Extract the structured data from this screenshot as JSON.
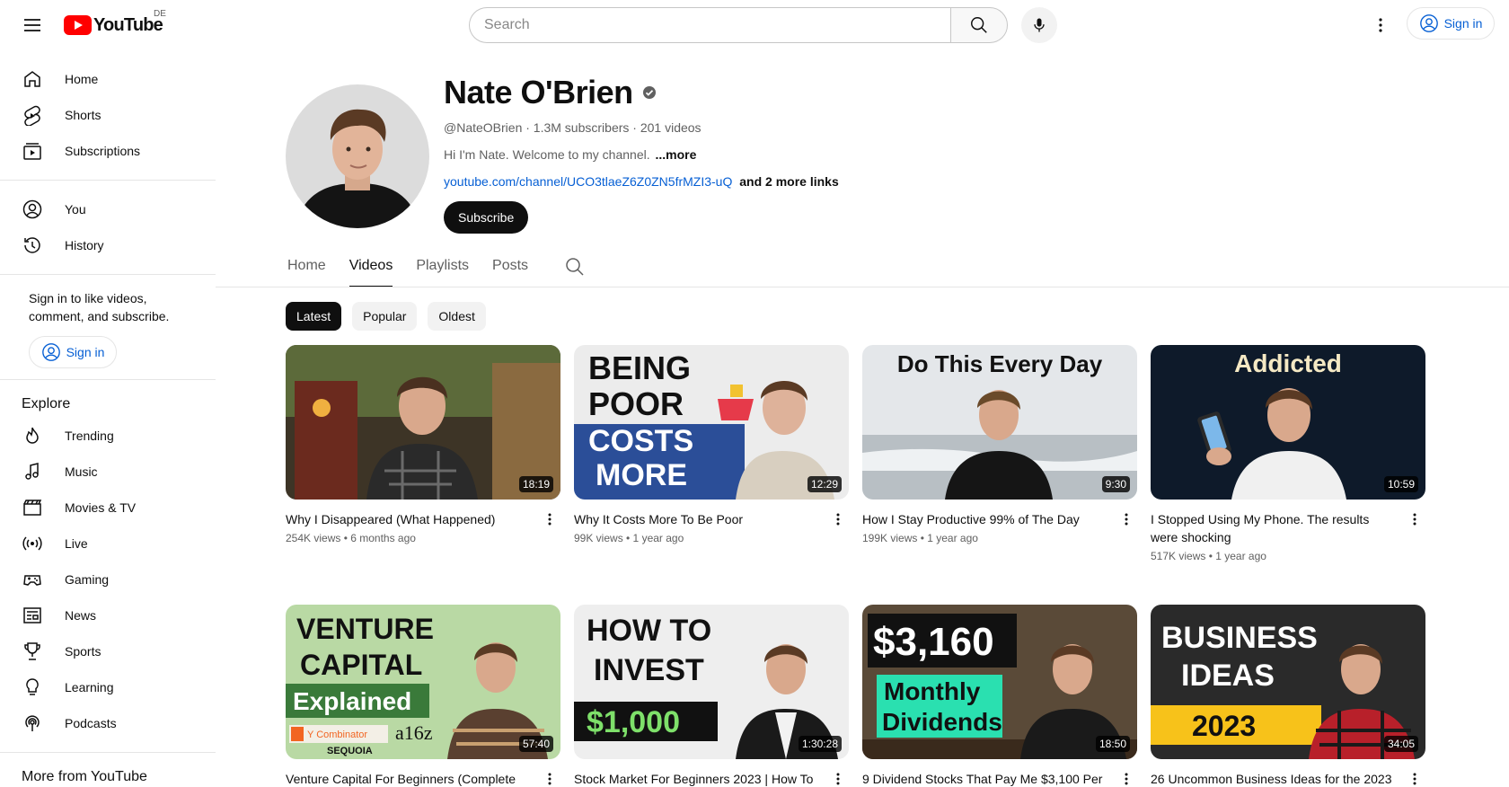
{
  "header": {
    "logo_text": "YouTube",
    "region": "DE",
    "search_placeholder": "Search",
    "sign_in": "Sign in"
  },
  "sidebar": {
    "main": [
      {
        "label": "Home",
        "icon": "home-icon"
      },
      {
        "label": "Shorts",
        "icon": "shorts-icon"
      },
      {
        "label": "Subscriptions",
        "icon": "subscriptions-icon"
      }
    ],
    "you": [
      {
        "label": "You",
        "icon": "user-icon"
      },
      {
        "label": "History",
        "icon": "history-icon"
      }
    ],
    "signin_note": "Sign in to like videos, comment, and subscribe.",
    "signin_button": "Sign in",
    "explore_title": "Explore",
    "explore": [
      {
        "label": "Trending",
        "icon": "trending-icon"
      },
      {
        "label": "Music",
        "icon": "music-icon"
      },
      {
        "label": "Movies & TV",
        "icon": "movies-icon"
      },
      {
        "label": "Live",
        "icon": "live-icon"
      },
      {
        "label": "Gaming",
        "icon": "gaming-icon"
      },
      {
        "label": "News",
        "icon": "news-icon"
      },
      {
        "label": "Sports",
        "icon": "sports-icon"
      },
      {
        "label": "Learning",
        "icon": "learning-icon"
      },
      {
        "label": "Podcasts",
        "icon": "podcasts-icon"
      }
    ],
    "more_title": "More from YouTube"
  },
  "channel": {
    "name": "Nate O'Brien",
    "meta": "@NateOBrien · 1.3M subscribers · 201 videos",
    "description": "Hi I'm Nate. Welcome to my channel.",
    "more": "...more",
    "link": "youtube.com/channel/UCO3tlaeZ6Z0ZN5frMZI3-uQ",
    "more_links": "and 2 more links",
    "subscribe": "Subscribe"
  },
  "tabs": [
    {
      "label": "Home",
      "active": false
    },
    {
      "label": "Videos",
      "active": true
    },
    {
      "label": "Playlists",
      "active": false
    },
    {
      "label": "Posts",
      "active": false
    }
  ],
  "chips": [
    {
      "label": "Latest",
      "active": true
    },
    {
      "label": "Popular",
      "active": false
    },
    {
      "label": "Oldest",
      "active": false
    }
  ],
  "videos": [
    {
      "title": "Why I Disappeared (What Happened)",
      "meta": "254K views • 6 months ago",
      "duration": "18:19",
      "thumb_text": []
    },
    {
      "title": "Why It Costs More To Be Poor",
      "meta": "99K views • 1 year ago",
      "duration": "12:29",
      "thumb_text": [
        "BEING",
        "POOR",
        "COSTS",
        "MORE"
      ]
    },
    {
      "title": "How I Stay Productive 99% of The Day",
      "meta": "199K views • 1 year ago",
      "duration": "9:30",
      "thumb_text": [
        "Do This Every Day"
      ]
    },
    {
      "title": "I Stopped Using My Phone. The results were shocking",
      "meta": "517K views • 1 year ago",
      "duration": "10:59",
      "thumb_text": [
        "Addicted"
      ]
    },
    {
      "title": "Venture Capital For Beginners (Complete",
      "meta": "",
      "duration": "57:40",
      "thumb_text": [
        "VENTURE",
        "CAPITAL",
        "Explained",
        "Y Combinator",
        "a16z",
        "SEQUOIA"
      ]
    },
    {
      "title": "Stock Market For Beginners 2023 | How To",
      "meta": "",
      "duration": "1:30:28",
      "thumb_text": [
        "HOW TO",
        "INVEST",
        "$1,000"
      ]
    },
    {
      "title": "9 Dividend Stocks That Pay Me $3,100 Per",
      "meta": "",
      "duration": "18:50",
      "thumb_text": [
        "$3,160",
        "Monthly",
        "Dividends"
      ]
    },
    {
      "title": "26 Uncommon Business Ideas for the 2023",
      "meta": "",
      "duration": "34:05",
      "thumb_text": [
        "BUSINESS",
        "IDEAS",
        "2023"
      ]
    }
  ]
}
